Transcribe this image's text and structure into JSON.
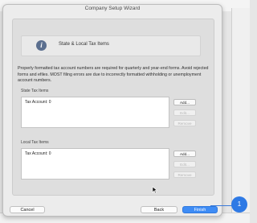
{
  "dialog": {
    "title": "Company Setup Wizard"
  },
  "info": {
    "icon": "info-icon",
    "title": "State & Local Tax Items"
  },
  "description": "Properly formatted tax account numbers are required for quarterly and year-end forms. Avoid rejected forms and efiles. MOST filing errors are due to incorrectly formatted withholding or unemployment account numbers.",
  "state_section": {
    "label": "State Tax Items",
    "items": [
      "Tax Account: 0"
    ],
    "buttons": {
      "add": "Add...",
      "edit": "Edit...",
      "remove": "Remove"
    }
  },
  "local_section": {
    "label": "Local Tax Items",
    "items": [
      "Tax Account: 0"
    ],
    "buttons": {
      "add": "Add...",
      "edit": "Edit...",
      "remove": "Remove"
    }
  },
  "footer": {
    "cancel": "Cancel",
    "back": "Back",
    "finish": "Finish"
  },
  "callout": {
    "number": "1",
    "color": "#2f7ae5"
  },
  "colors": {
    "accent": "#3e8cf5"
  }
}
